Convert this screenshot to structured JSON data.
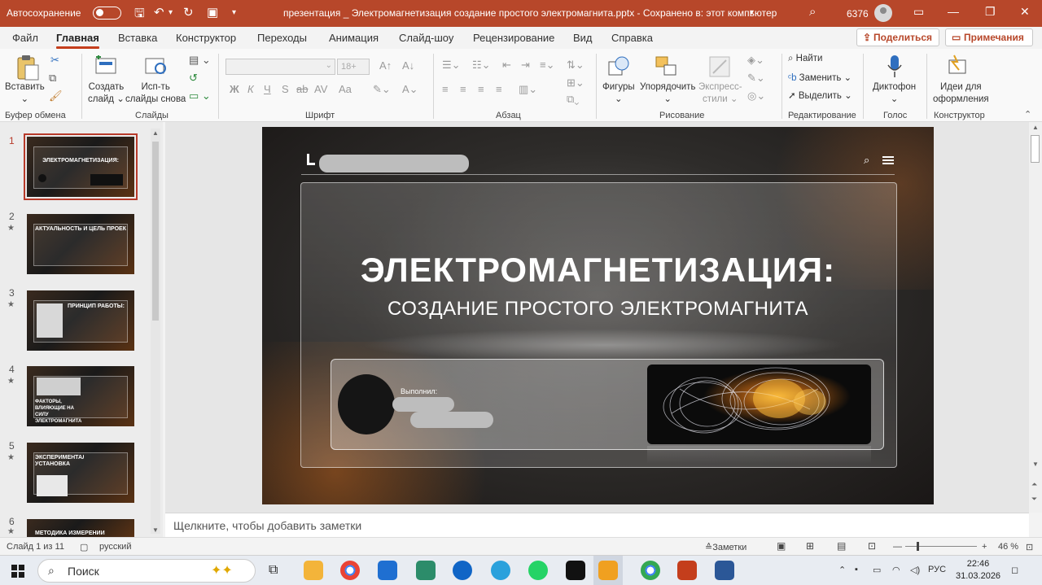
{
  "titlebar": {
    "autosave": "Автосохранение",
    "doc_title": "презентация _ Электромагнетизация создание простого электромагнита.pptx  -  Сохранено в: этот компьютер",
    "counter": "6376",
    "accent": "#b7472a"
  },
  "menu": {
    "tabs": [
      "Файл",
      "Главная",
      "Вставка",
      "Конструктор",
      "Переходы",
      "Анимация",
      "Слайд-шоу",
      "Рецензирование",
      "Вид",
      "Справка"
    ],
    "active": "Главная",
    "share": "Поделиться",
    "comments": "Примечания"
  },
  "ribbon": {
    "groups": {
      "clipboard": "Буфер обмена",
      "slides": "Слайды",
      "font": "Шрифт",
      "paragraph": "Абзац",
      "drawing": "Рисование",
      "editing": "Редактирование",
      "voice": "Голос",
      "designer": "Конструктор"
    },
    "paste": "Вставить",
    "new_slide_1": "Создать",
    "new_slide_2": "слайд",
    "reuse_1": "Исп-ть",
    "reuse_2": "слайды снова",
    "font_size": "18+",
    "font_buttons": [
      "Ж",
      "К",
      "Ч",
      "S",
      "ab",
      "AV",
      "Aa"
    ],
    "shapes": "Фигуры",
    "arrange": "Упорядочить",
    "quick_styles_1": "Экспресс-",
    "quick_styles_2": "стили",
    "find": "Найти",
    "replace": "Заменить",
    "select": "Выделить",
    "dictate": "Диктофон",
    "design_ideas_1": "Идеи для",
    "design_ideas_2": "оформления"
  },
  "slides_panel": {
    "thumbs": [
      {
        "num": "1",
        "text": "ЭЛЕКТРОМАГНЕТИЗАЦИЯ:"
      },
      {
        "num": "2",
        "text": "АКТУАЛЬНОСТЬ И ЦЕЛЬ ПРОЕКТА"
      },
      {
        "num": "3",
        "text": "ПРИНЦИП РАБОТЫ:"
      },
      {
        "num": "4",
        "text": "ФАКТОРЫ, ВЛИЯЮЩИЕ НА СИЛУ ЭЛЕКТРОМАГНИТА"
      },
      {
        "num": "5",
        "text": "ЭКСПЕРИМЕНТАЛЬНАЯ УСТАНОВКА"
      },
      {
        "num": "6",
        "text": "МЕТОДИКА ИЗМЕРЕНИЙ"
      }
    ],
    "star": "★"
  },
  "slide": {
    "title": "ЭЛЕКТРОМАГНЕТИЗАЦИЯ:",
    "subtitle": "СОЗДАНИЕ ПРОСТОГО ЭЛЕКТРОМАГНИТА",
    "author_label": "Выполнил:"
  },
  "notes": {
    "placeholder": "Щелкните, чтобы добавить заметки"
  },
  "status": {
    "slide_info": "Слайд 1 из 11",
    "language": "русский",
    "notes_btn": "Заметки",
    "zoom": "46 %"
  },
  "taskbar": {
    "search": "Поиск",
    "lang": "РУС",
    "time": "22:46",
    "date": "31.03.2026"
  }
}
